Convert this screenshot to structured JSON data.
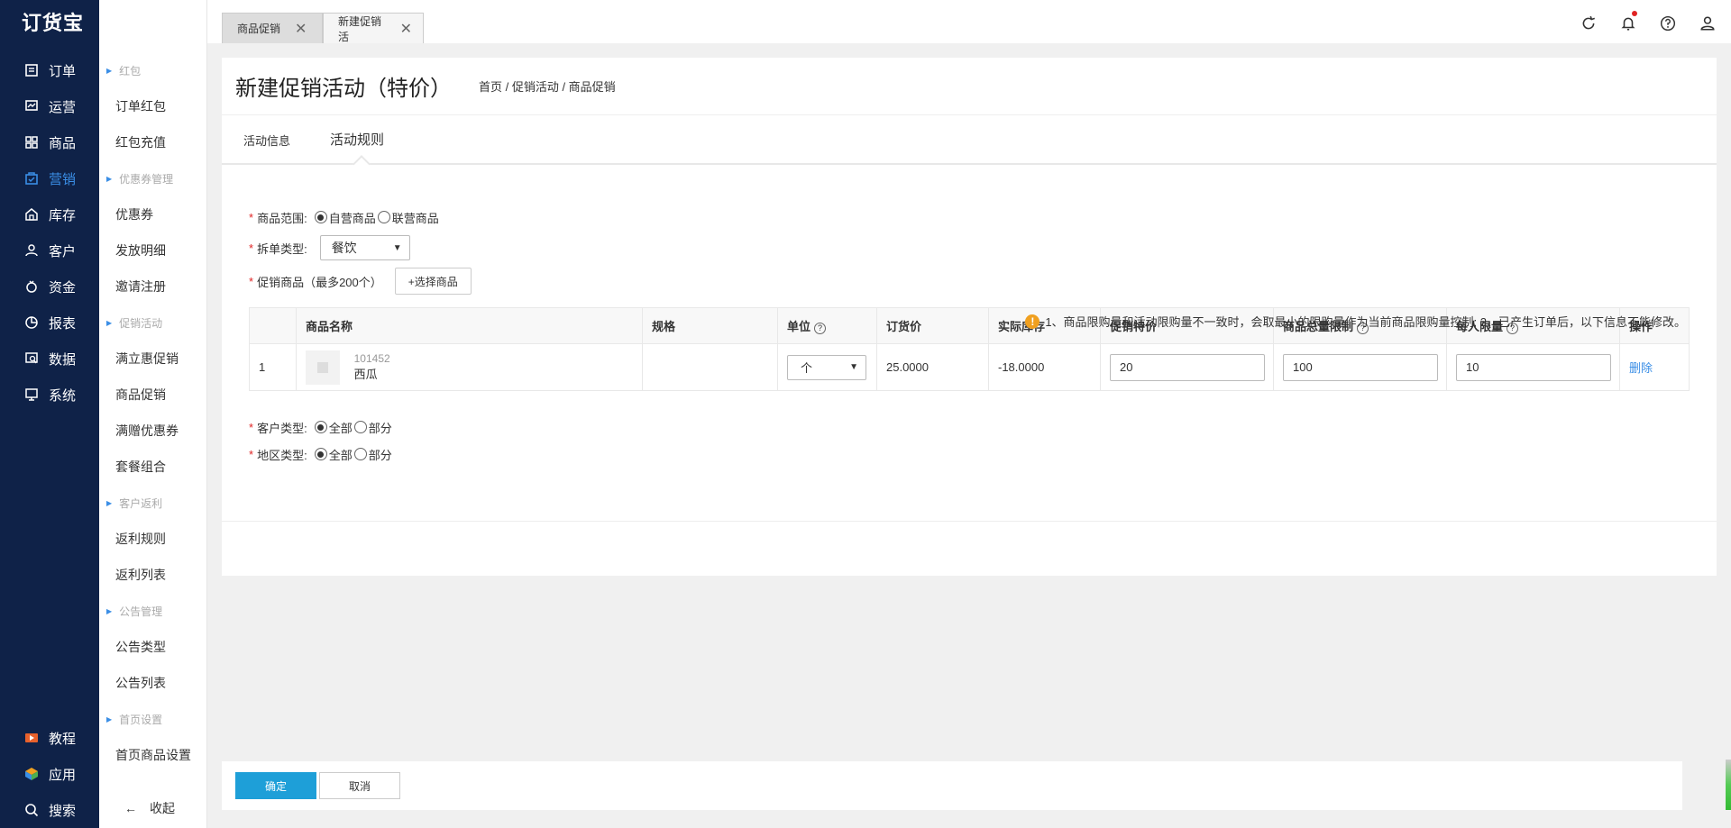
{
  "app": {
    "logo": "订货宝"
  },
  "leftnav": {
    "items": [
      {
        "label": "订单",
        "icon": "order-icon"
      },
      {
        "label": "运营",
        "icon": "operations-icon"
      },
      {
        "label": "商品",
        "icon": "goods-icon"
      },
      {
        "label": "营销",
        "icon": "marketing-icon",
        "active": true
      },
      {
        "label": "库存",
        "icon": "inventory-icon"
      },
      {
        "label": "客户",
        "icon": "customer-icon"
      },
      {
        "label": "资金",
        "icon": "funds-icon"
      },
      {
        "label": "报表",
        "icon": "report-icon"
      },
      {
        "label": "数据",
        "icon": "data-icon"
      },
      {
        "label": "系统",
        "icon": "system-icon"
      }
    ],
    "bottom": [
      {
        "label": "教程",
        "icon": "tutorial-icon"
      },
      {
        "label": "应用",
        "icon": "apps-icon"
      },
      {
        "label": "搜索",
        "icon": "search-icon"
      }
    ]
  },
  "submenu": {
    "groups": [
      {
        "title": "红包",
        "items": [
          "订单红包",
          "红包充值"
        ]
      },
      {
        "title": "优惠券管理",
        "items": [
          "优惠券",
          "发放明细",
          "邀请注册"
        ]
      },
      {
        "title": "促销活动",
        "items": [
          "满立惠促销",
          "商品促销",
          "满赠优惠券",
          "套餐组合"
        ]
      },
      {
        "title": "客户返利",
        "items": [
          "返利规则",
          "返利列表"
        ]
      },
      {
        "title": "公告管理",
        "items": [
          "公告类型",
          "公告列表"
        ]
      },
      {
        "title": "首页设置",
        "items": [
          "首页商品设置"
        ]
      }
    ],
    "collapse": "收起"
  },
  "tabs": [
    {
      "label": "商品促销"
    },
    {
      "label": "新建促销活"
    }
  ],
  "page": {
    "title": "新建促销活动（特价）",
    "breadcrumb": "首页 / 促销活动 / 商品促销",
    "subtabs": [
      "活动信息",
      "活动规则"
    ]
  },
  "form": {
    "scope_label": "商品范围:",
    "scope_options": [
      "自营商品",
      "联营商品"
    ],
    "split_label": "拆单类型:",
    "split_value": "餐饮",
    "promo_label": "促销商品（最多200个）",
    "choose_button": "+选择商品",
    "notice": "1、商品限购量和活动限购量不一致时，会取最小的限购量作为当前商品限购量控制; 2、已产生订单后，以下信息不能修改。",
    "customer_label": "客户类型:",
    "customer_options": [
      "全部",
      "部分"
    ],
    "region_label": "地区类型:",
    "region_options": [
      "全部",
      "部分"
    ]
  },
  "table": {
    "headers": [
      "",
      "商品名称",
      "规格",
      "单位",
      "订货价",
      "实际库存",
      "促销特价",
      "商品总量限制",
      "每人限量",
      "操作"
    ],
    "rows": [
      {
        "index": "1",
        "code": "101452",
        "name": "西瓜",
        "spec": "",
        "unit": "个",
        "price": "25.0000",
        "stock": "-18.0000",
        "promo_price": "20",
        "total_limit": "100",
        "per_limit": "10",
        "action": "删除"
      }
    ]
  },
  "footer": {
    "ok": "确定",
    "cancel": "取消"
  },
  "colors": {
    "nav_bg": "#0f2248",
    "accent": "#3a8ee6",
    "ok_button": "#1e9fd8",
    "required": "#e02424",
    "warning": "#f0a020"
  }
}
